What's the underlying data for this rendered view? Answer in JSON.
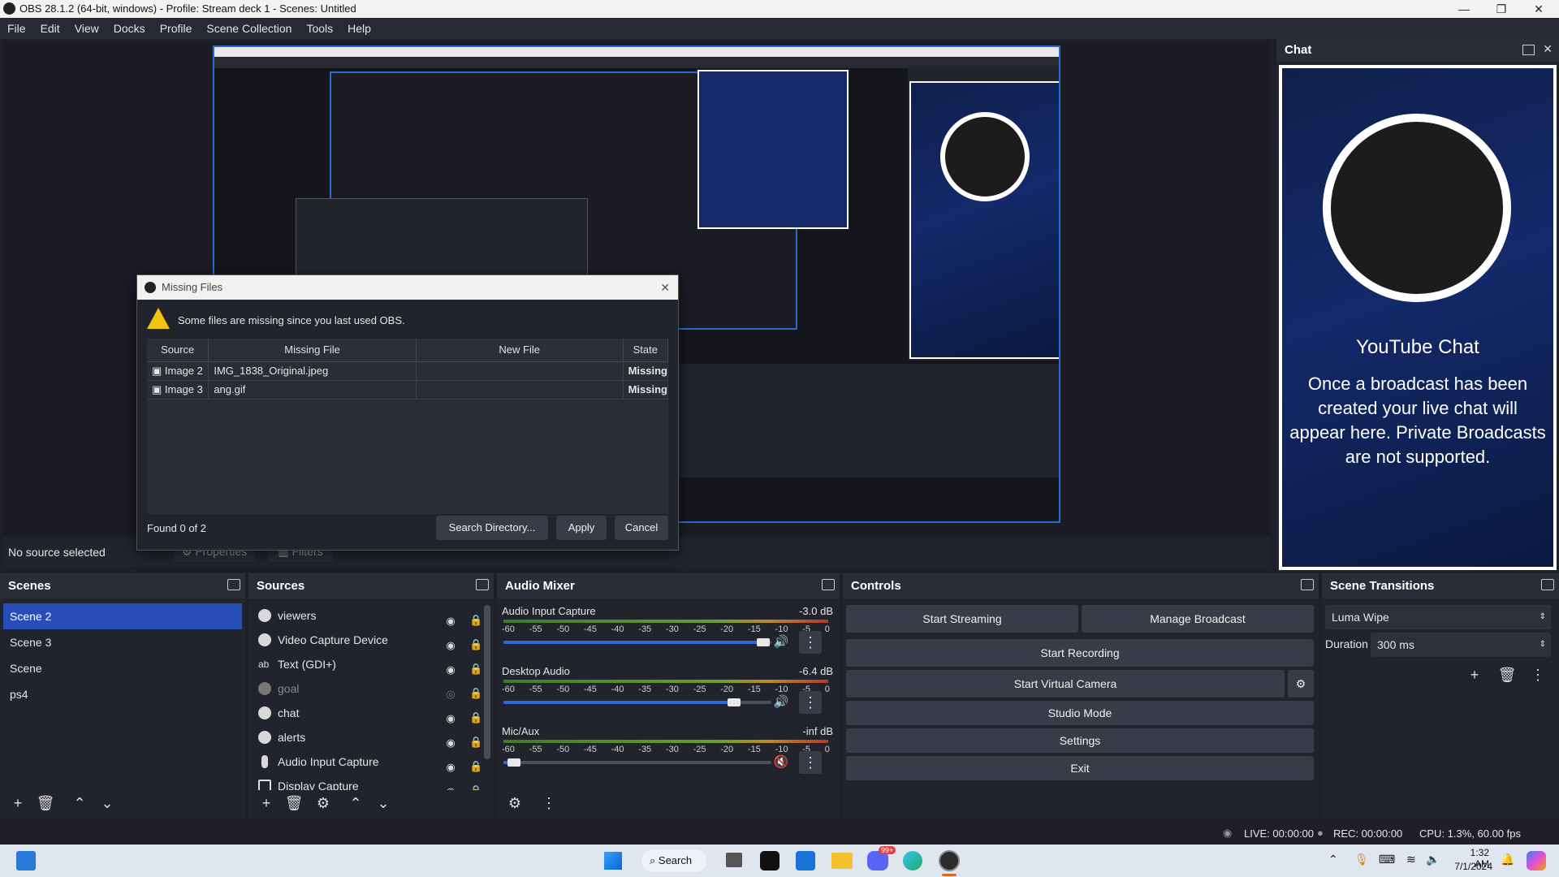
{
  "window": {
    "title": "OBS 28.1.2 (64-bit, windows) - Profile: Stream deck 1 - Scenes: Untitled"
  },
  "menu": [
    "File",
    "Edit",
    "View",
    "Docks",
    "Profile",
    "Scene Collection",
    "Tools",
    "Help"
  ],
  "chat": {
    "title": "Chat",
    "yt_title": "YouTube Chat",
    "yt_message": "Once a broadcast has been created your live chat will appear here. Private Broadcasts are not supported."
  },
  "preview_bar": {
    "no_source": "No source selected",
    "properties": "Properties",
    "filters": "Filters"
  },
  "dialog": {
    "title": "Missing Files",
    "warning": "Some files are missing since you last used OBS.",
    "columns": [
      "Source",
      "Missing File",
      "New File",
      "State"
    ],
    "rows": [
      {
        "source": "Image 2",
        "missing": "IMG_1838_Original.jpeg",
        "new": "",
        "state": "Missing"
      },
      {
        "source": "Image 3",
        "missing": "ang.gif",
        "new": "",
        "state": "Missing"
      }
    ],
    "found": "Found 0 of 2",
    "search": "Search Directory...",
    "apply": "Apply",
    "cancel": "Cancel"
  },
  "scenes": {
    "title": "Scenes",
    "items": [
      "Scene 2",
      "Scene 3",
      "Scene",
      "ps4"
    ],
    "selected": "Scene 2"
  },
  "sources": {
    "title": "Sources",
    "items": [
      {
        "name": "viewers",
        "icon": "globe-icon",
        "visible": true
      },
      {
        "name": "Video Capture Device",
        "icon": "camera-icon",
        "visible": true
      },
      {
        "name": "Text (GDI+)",
        "icon": "text-icon",
        "visible": true
      },
      {
        "name": "goal",
        "icon": "globe-icon",
        "visible": false
      },
      {
        "name": "chat",
        "icon": "globe-icon",
        "visible": true
      },
      {
        "name": "alerts",
        "icon": "globe-icon",
        "visible": true
      },
      {
        "name": "Audio Input Capture",
        "icon": "mic-icon",
        "visible": true
      },
      {
        "name": "Display Capture",
        "icon": "monitor-icon",
        "visible": true
      }
    ]
  },
  "mixer": {
    "title": "Audio Mixer",
    "ticks": [
      "-60",
      "-55",
      "-50",
      "-45",
      "-40",
      "-35",
      "-30",
      "-25",
      "-20",
      "-15",
      "-10",
      "-5",
      "0"
    ],
    "channels": [
      {
        "name": "Audio Input Capture",
        "level": "-3.0 dB",
        "volume": 0.97,
        "muted": false
      },
      {
        "name": "Desktop Audio",
        "level": "-6.4 dB",
        "volume": 0.86,
        "muted": false
      },
      {
        "name": "Mic/Aux",
        "level": "-inf dB",
        "volume": 0.04,
        "muted": true
      }
    ]
  },
  "controls": {
    "title": "Controls",
    "start_streaming": "Start Streaming",
    "manage_broadcast": "Manage Broadcast",
    "start_recording": "Start Recording",
    "start_virtual_camera": "Start Virtual Camera",
    "studio_mode": "Studio Mode",
    "settings": "Settings",
    "exit": "Exit"
  },
  "transitions": {
    "title": "Scene Transitions",
    "selected": "Luma Wipe",
    "duration_label": "Duration",
    "duration": "300 ms"
  },
  "status": {
    "live": "LIVE: 00:00:00",
    "rec": "REC: 00:00:00",
    "cpu": "CPU: 1.3%, 60.00 fps"
  },
  "taskbar": {
    "search": "Search",
    "time": "1:32 AM",
    "date": "7/1/2024",
    "badge": "99+"
  }
}
